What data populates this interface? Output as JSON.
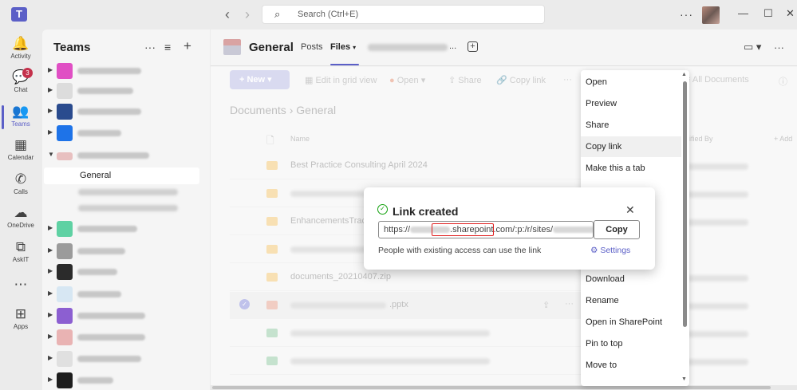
{
  "search": {
    "placeholder": "Search (Ctrl+E)"
  },
  "rail": [
    {
      "label": "Activity",
      "icon": "bell-icon",
      "glyph": "🔔"
    },
    {
      "label": "Chat",
      "icon": "chat-icon",
      "glyph": "💬",
      "badge": "3"
    },
    {
      "label": "Teams",
      "icon": "teams-icon",
      "glyph": "👥"
    },
    {
      "label": "Calendar",
      "icon": "calendar-icon",
      "glyph": "▦"
    },
    {
      "label": "Calls",
      "icon": "phone-icon",
      "glyph": "✆"
    },
    {
      "label": "OneDrive",
      "icon": "cloud-icon",
      "glyph": "☁"
    },
    {
      "label": "AskIT",
      "icon": "app-grid-icon",
      "glyph": "⧉"
    },
    {
      "label": "",
      "icon": "more-icon",
      "glyph": "⋯"
    },
    {
      "label": "Apps",
      "icon": "add-app-icon",
      "glyph": "⊞"
    }
  ],
  "teams_pane": {
    "title": "Teams",
    "active_channel": "General"
  },
  "channel": {
    "title": "General",
    "tabs": [
      "Posts",
      "Files"
    ],
    "more_tabs": "..."
  },
  "toolbar": {
    "new": "New",
    "edit_grid": "Edit in grid view",
    "open": "Open",
    "share": "Share",
    "copy_link": "Copy link",
    "view": "All Documents"
  },
  "breadcrumb": {
    "root": "Documents",
    "current": "General"
  },
  "columns": {
    "name": "Name",
    "modified_by": "odified By",
    "add": "+ Add"
  },
  "files": [
    {
      "name": "Best Practice Consulting April 2024",
      "type": "folder"
    },
    {
      "name": "",
      "type": "folder"
    },
    {
      "name": "EnhancementsTrack",
      "type": "folder"
    },
    {
      "name": "",
      "type": "folder"
    },
    {
      "name": "documents_20210407.zip",
      "type": "zip"
    },
    {
      "name": ".pptx",
      "type": "pptx"
    },
    {
      "name": "",
      "type": "xlsx"
    },
    {
      "name": "",
      "type": "xlsx"
    }
  ],
  "context_menu": {
    "items_top": [
      "Open",
      "Preview",
      "Share",
      "Copy link",
      "Make this a tab"
    ],
    "items_bottom": [
      "Download",
      "Rename",
      "Open in SharePoint",
      "Pin to top",
      "Move to"
    ],
    "hover": "Copy link"
  },
  "dialog": {
    "title": "Link created",
    "link_prefix": "https://",
    "link_domain": ".sharepoint.com",
    "link_suffix": "/:p:/r/sites/",
    "copy_button": "Copy",
    "note": "People with existing access can use the link",
    "settings": "Settings"
  },
  "colors": {
    "accent": "#5b5fc7",
    "badge": "#c4314b",
    "success": "#13a10e",
    "highlight": "#e02020"
  }
}
